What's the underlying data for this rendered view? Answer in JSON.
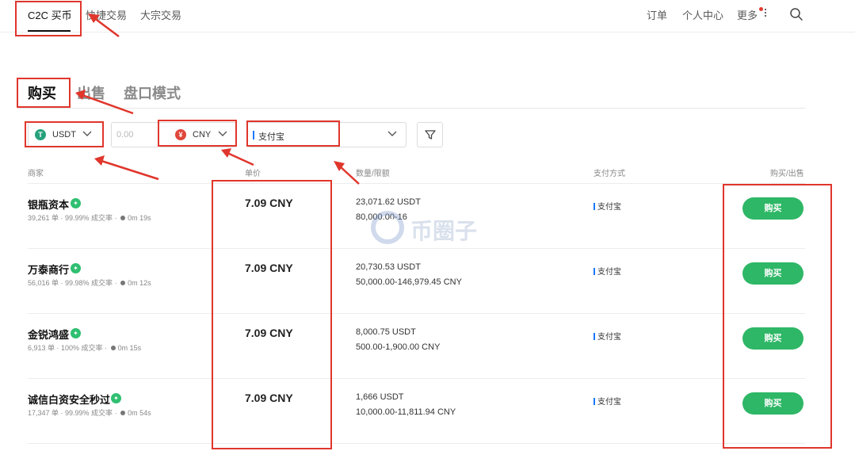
{
  "topnav": {
    "tabs": [
      {
        "label": "C2C 买币"
      },
      {
        "label": "快捷交易"
      },
      {
        "label": "大宗交易"
      }
    ],
    "right": {
      "orders": "订单",
      "profile": "个人中心",
      "more": "更多"
    }
  },
  "mode_tabs": [
    {
      "label": "购买"
    },
    {
      "label": "出售"
    },
    {
      "label": "盘口模式"
    }
  ],
  "filters": {
    "coin": {
      "icon_letter": "T",
      "value": "USDT"
    },
    "amount": {
      "placeholder": "0.00"
    },
    "fiat": {
      "icon_letter": "¥",
      "value": "CNY"
    },
    "payment": {
      "value": "支付宝"
    }
  },
  "table": {
    "headers": {
      "merchant": "商家",
      "price": "单价",
      "quantity": "数量/限额",
      "payment": "支付方式",
      "action": "购买/出售"
    },
    "rows": [
      {
        "name": "银瓶资本",
        "orders": "39,261 单",
        "completion": "99.99% 成交率",
        "time": "0m 19s",
        "price": "7.09 CNY",
        "quantity": "23,071.62 USDT",
        "limit": "80,000.00-16",
        "payment": "支付宝",
        "button": "购买"
      },
      {
        "name": "万泰商行",
        "orders": "56,016 单",
        "completion": "99.98% 成交率",
        "time": "0m 12s",
        "price": "7.09 CNY",
        "quantity": "20,730.53 USDT",
        "limit": "50,000.00-146,979.45 CNY",
        "payment": "支付宝",
        "button": "购买"
      },
      {
        "name": "金锐鸿盛",
        "orders": "6,913 单",
        "completion": "100% 成交率",
        "time": "0m 15s",
        "price": "7.09 CNY",
        "quantity": "8,000.75 USDT",
        "limit": "500.00-1,900.00 CNY",
        "payment": "支付宝",
        "button": "购买"
      },
      {
        "name": "诚信白资安全秒过",
        "orders": "17,347 单",
        "completion": "99.99% 成交率",
        "time": "0m 54s",
        "price": "7.09 CNY",
        "quantity": "1,666 USDT",
        "limit": "10,000.00-11,811.94 CNY",
        "payment": "支付宝",
        "button": "购买"
      }
    ]
  },
  "watermark": "币圈子",
  "colors": {
    "accent_green": "#2eb766",
    "annotation_red": "#e0362c",
    "usdt_green": "#26a17b",
    "cny_red": "#e0463a"
  }
}
